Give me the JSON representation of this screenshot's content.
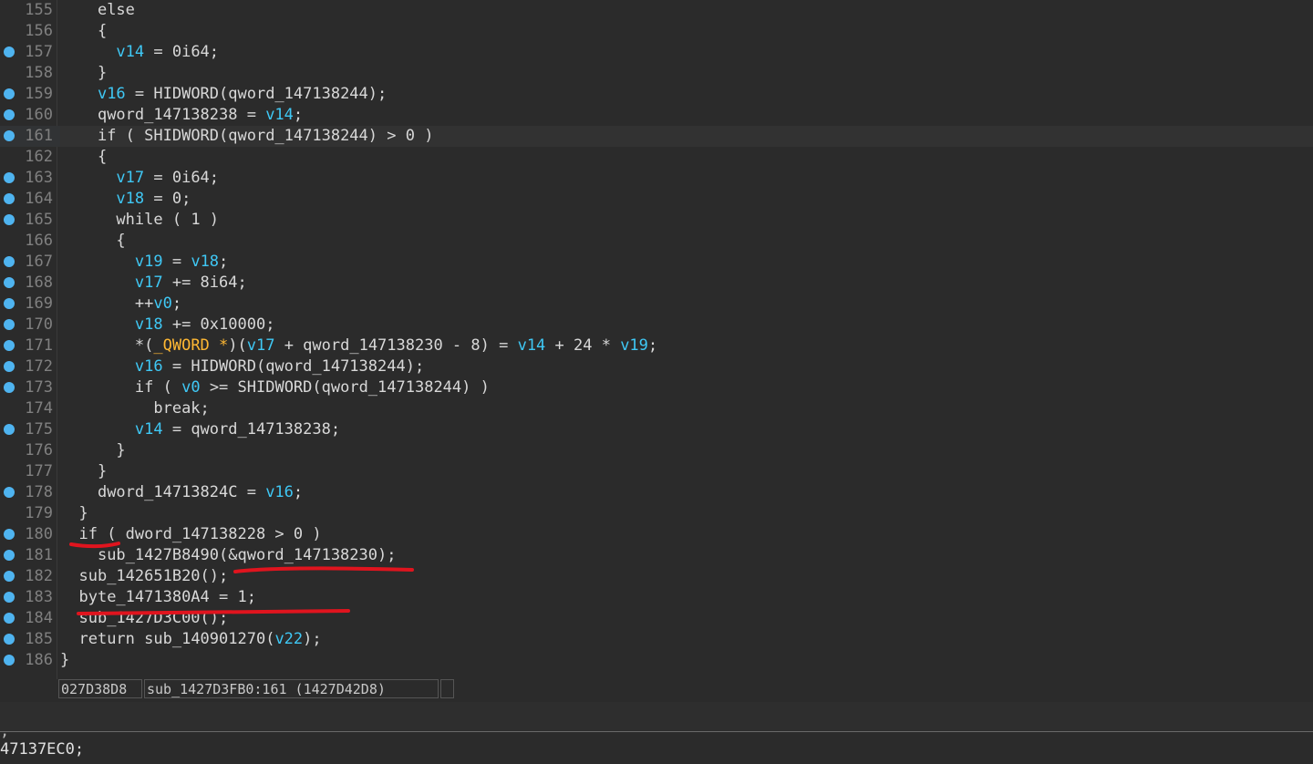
{
  "editor": {
    "lines": [
      {
        "num": "155",
        "bp": false,
        "indent": "    ",
        "tokens": [
          [
            "kw",
            "else"
          ]
        ]
      },
      {
        "num": "156",
        "bp": false,
        "indent": "    ",
        "tokens": [
          [
            "plain",
            "{"
          ]
        ]
      },
      {
        "num": "157",
        "bp": true,
        "indent": "      ",
        "tokens": [
          [
            "var",
            "v14"
          ],
          [
            "plain",
            " = 0i64;"
          ]
        ]
      },
      {
        "num": "158",
        "bp": false,
        "indent": "    ",
        "tokens": [
          [
            "plain",
            "}"
          ]
        ]
      },
      {
        "num": "159",
        "bp": true,
        "indent": "    ",
        "tokens": [
          [
            "var",
            "v16"
          ],
          [
            "plain",
            " = HIDWORD(qword_147138244);"
          ]
        ]
      },
      {
        "num": "160",
        "bp": true,
        "indent": "    ",
        "tokens": [
          [
            "plain",
            "qword_147138238 = "
          ],
          [
            "var",
            "v14"
          ],
          [
            "plain",
            ";"
          ]
        ]
      },
      {
        "num": "161",
        "bp": true,
        "indent": "    ",
        "current": true,
        "tokens": [
          [
            "kw",
            "if"
          ],
          [
            "plain",
            " ( SHIDWORD(qword_147138244) > 0 )"
          ]
        ]
      },
      {
        "num": "162",
        "bp": false,
        "indent": "    ",
        "tokens": [
          [
            "plain",
            "{"
          ]
        ]
      },
      {
        "num": "163",
        "bp": true,
        "indent": "      ",
        "tokens": [
          [
            "var",
            "v17"
          ],
          [
            "plain",
            " = 0i64;"
          ]
        ]
      },
      {
        "num": "164",
        "bp": true,
        "indent": "      ",
        "tokens": [
          [
            "var",
            "v18"
          ],
          [
            "plain",
            " = 0;"
          ]
        ]
      },
      {
        "num": "165",
        "bp": true,
        "indent": "      ",
        "tokens": [
          [
            "kw",
            "while"
          ],
          [
            "plain",
            " ( 1 )"
          ]
        ]
      },
      {
        "num": "166",
        "bp": false,
        "indent": "      ",
        "tokens": [
          [
            "plain",
            "{"
          ]
        ]
      },
      {
        "num": "167",
        "bp": true,
        "indent": "        ",
        "tokens": [
          [
            "var",
            "v19"
          ],
          [
            "plain",
            " = "
          ],
          [
            "var",
            "v18"
          ],
          [
            "plain",
            ";"
          ]
        ]
      },
      {
        "num": "168",
        "bp": true,
        "indent": "        ",
        "tokens": [
          [
            "var",
            "v17"
          ],
          [
            "plain",
            " += 8i64;"
          ]
        ]
      },
      {
        "num": "169",
        "bp": true,
        "indent": "        ",
        "tokens": [
          [
            "plain",
            "++"
          ],
          [
            "var",
            "v0"
          ],
          [
            "plain",
            ";"
          ]
        ]
      },
      {
        "num": "170",
        "bp": true,
        "indent": "        ",
        "tokens": [
          [
            "var",
            "v18"
          ],
          [
            "plain",
            " += 0x10000;"
          ]
        ]
      },
      {
        "num": "171",
        "bp": true,
        "indent": "        ",
        "tokens": [
          [
            "plain",
            "*("
          ],
          [
            "type",
            "_QWORD *"
          ],
          [
            "plain",
            ")("
          ],
          [
            "var",
            "v17"
          ],
          [
            "plain",
            " + qword_147138230 - 8) = "
          ],
          [
            "var",
            "v14"
          ],
          [
            "plain",
            " + 24 * "
          ],
          [
            "var",
            "v19"
          ],
          [
            "plain",
            ";"
          ]
        ]
      },
      {
        "num": "172",
        "bp": true,
        "indent": "        ",
        "tokens": [
          [
            "var",
            "v16"
          ],
          [
            "plain",
            " = HIDWORD(qword_147138244);"
          ]
        ]
      },
      {
        "num": "173",
        "bp": true,
        "indent": "        ",
        "tokens": [
          [
            "kw",
            "if"
          ],
          [
            "plain",
            " ( "
          ],
          [
            "var",
            "v0"
          ],
          [
            "plain",
            " >= SHIDWORD(qword_147138244) )"
          ]
        ]
      },
      {
        "num": "174",
        "bp": false,
        "indent": "          ",
        "tokens": [
          [
            "kw",
            "break"
          ],
          [
            "plain",
            ";"
          ]
        ]
      },
      {
        "num": "175",
        "bp": true,
        "indent": "        ",
        "tokens": [
          [
            "var",
            "v14"
          ],
          [
            "plain",
            " = qword_147138238;"
          ]
        ]
      },
      {
        "num": "176",
        "bp": false,
        "indent": "      ",
        "tokens": [
          [
            "plain",
            "}"
          ]
        ]
      },
      {
        "num": "177",
        "bp": false,
        "indent": "    ",
        "tokens": [
          [
            "plain",
            "}"
          ]
        ]
      },
      {
        "num": "178",
        "bp": true,
        "indent": "    ",
        "tokens": [
          [
            "plain",
            "dword_14713824C = "
          ],
          [
            "var",
            "v16"
          ],
          [
            "plain",
            ";"
          ]
        ]
      },
      {
        "num": "179",
        "bp": false,
        "indent": "  ",
        "tokens": [
          [
            "plain",
            "}"
          ]
        ]
      },
      {
        "num": "180",
        "bp": true,
        "indent": "  ",
        "tokens": [
          [
            "kw",
            "if"
          ],
          [
            "plain",
            " ( dword_147138228 > 0 )"
          ]
        ]
      },
      {
        "num": "181",
        "bp": true,
        "indent": "    ",
        "tokens": [
          [
            "plain",
            "sub_1427B8490(&qword_147138230);"
          ]
        ]
      },
      {
        "num": "182",
        "bp": true,
        "indent": "  ",
        "tokens": [
          [
            "plain",
            "sub_142651B20();"
          ]
        ]
      },
      {
        "num": "183",
        "bp": true,
        "indent": "  ",
        "tokens": [
          [
            "plain",
            "byte_1471380A4 = 1;"
          ]
        ]
      },
      {
        "num": "184",
        "bp": true,
        "indent": "  ",
        "tokens": [
          [
            "plain",
            "sub_1427D3C00();"
          ]
        ]
      },
      {
        "num": "185",
        "bp": true,
        "indent": "  ",
        "tokens": [
          [
            "kw",
            "return"
          ],
          [
            "plain",
            " sub_140901270("
          ],
          [
            "var",
            "v22"
          ],
          [
            "plain",
            ");"
          ]
        ]
      },
      {
        "num": "186",
        "bp": true,
        "indent": "",
        "tokens": [
          [
            "plain",
            "}"
          ]
        ]
      }
    ]
  },
  "status": {
    "offset": "027D38D8",
    "location": "sub_1427D3FB0:161 (1427D42D8)",
    "empty": ""
  },
  "bottom_pane": {
    "line1": "47137EC0;"
  },
  "colors": {
    "background": "#2b2b2b",
    "variable": "#3fc8f5",
    "type": "#ffb833",
    "breakpoint": "#4fb4f0",
    "annotation": "#e0141e"
  }
}
